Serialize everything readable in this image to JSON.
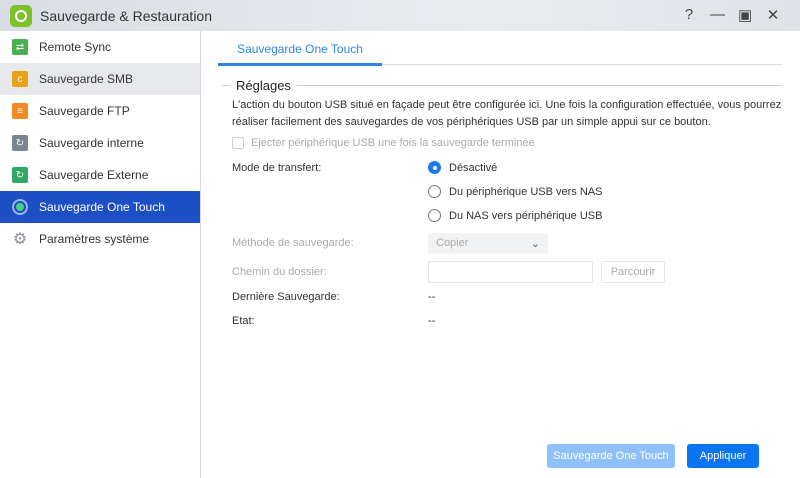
{
  "window": {
    "title": "Sauvegarde & Restauration",
    "help": "?",
    "minimize": "—",
    "maximize": "▣",
    "close": "✕"
  },
  "sidebar": {
    "items": [
      {
        "label": "Remote Sync",
        "color": "#4caf50"
      },
      {
        "label": "Sauvegarde SMB",
        "color": "#e6a317"
      },
      {
        "label": "Sauvegarde FTP",
        "color": "#f08a24"
      },
      {
        "label": "Sauvegarde interne",
        "color": "#7a8590"
      },
      {
        "label": "Sauvegarde Externe",
        "color": "#2fa865"
      },
      {
        "label": "Sauvegarde One Touch",
        "color": "#4bd07a"
      },
      {
        "label": "Paramètres système",
        "color": "#8a8f96"
      }
    ]
  },
  "tab": "Sauvegarde One Touch",
  "section": {
    "title": "Réglages",
    "description": "L'action du bouton USB situé en façade peut être configurée ici. Une fois la configuration effectuée, vous pourrez réaliser facilement des sauvegardes de vos périphériques USB par un simple appui sur ce bouton."
  },
  "form": {
    "eject_label": "Ejecter périphérique USB une fois la sauvegarde terminée",
    "mode_label": "Mode de transfert:",
    "modes": [
      "Désactivé",
      "Du périphérique USB vers NAS",
      "Du NAS vers périphérique USB"
    ],
    "method_label": "Méthode de sauvegarde:",
    "method_value": "Copier",
    "path_label": "Chemin du dossier:",
    "path_value": "",
    "browse": "Parcourir",
    "last_label": "Dernière Sauvegarde:",
    "last_value": "--",
    "state_label": "Etat:",
    "state_value": "--"
  },
  "buttons": {
    "one_touch": "Sauvegarde One Touch",
    "apply": "Appliquer"
  }
}
